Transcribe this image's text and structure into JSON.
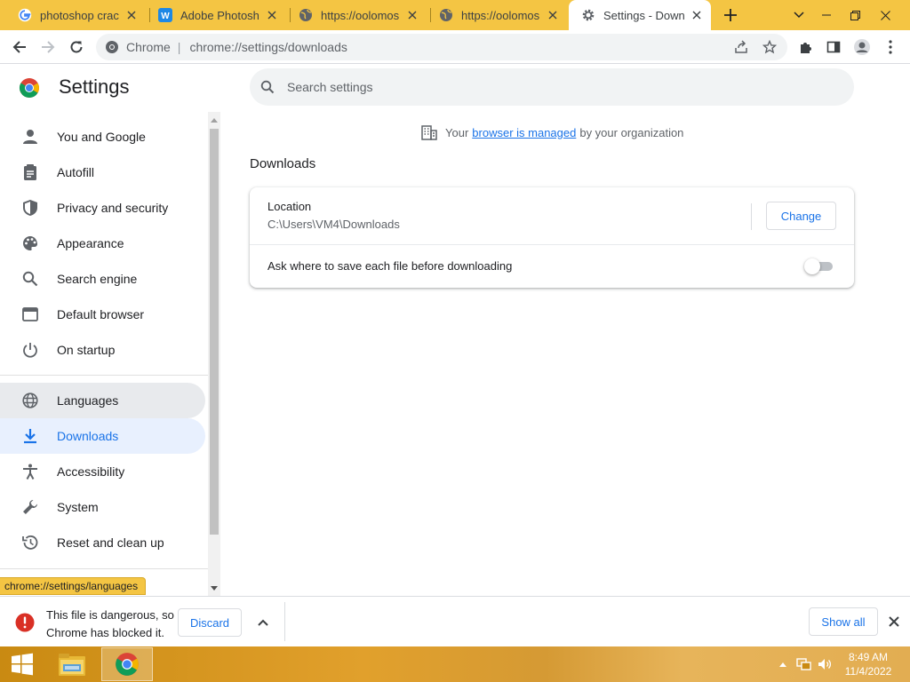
{
  "tabs": [
    {
      "title": "photoshop crack",
      "icon": "google-icon"
    },
    {
      "title": "Adobe Photoshop",
      "icon": "w-site-icon"
    },
    {
      "title": "https://oolomos.c",
      "icon": "globe-icon"
    },
    {
      "title": "https://oolomos.c",
      "icon": "globe-icon"
    },
    {
      "title": "Settings - Downlo",
      "icon": "gear-icon",
      "active": true
    }
  ],
  "toolbar": {
    "site_label": "Chrome",
    "url": "chrome://settings/downloads"
  },
  "settings": {
    "title": "Settings",
    "search_placeholder": "Search settings"
  },
  "sidebar": {
    "items": [
      {
        "label": "You and Google",
        "icon": "person-icon"
      },
      {
        "label": "Autofill",
        "icon": "clipboard-icon"
      },
      {
        "label": "Privacy and security",
        "icon": "shield-icon"
      },
      {
        "label": "Appearance",
        "icon": "palette-icon"
      },
      {
        "label": "Search engine",
        "icon": "search-icon"
      },
      {
        "label": "Default browser",
        "icon": "browser-window-icon"
      },
      {
        "label": "On startup",
        "icon": "power-icon"
      },
      {
        "label": "Languages",
        "icon": "globe-icon",
        "state": "hover"
      },
      {
        "label": "Downloads",
        "icon": "download-icon",
        "state": "selected"
      },
      {
        "label": "Accessibility",
        "icon": "accessibility-icon"
      },
      {
        "label": "System",
        "icon": "wrench-icon"
      },
      {
        "label": "Reset and clean up",
        "icon": "history-reset-icon"
      }
    ],
    "status_url": "chrome://settings/languages"
  },
  "managed": {
    "prefix": "Your",
    "link": "browser is managed",
    "suffix": "by your organization"
  },
  "downloads": {
    "section_title": "Downloads",
    "location_label": "Location",
    "location_path": "C:\\Users\\VM4\\Downloads",
    "change_label": "Change",
    "ask_label": "Ask where to save each file before downloading",
    "ask_enabled": false
  },
  "shelf": {
    "message": "This file is dangerous, so Chrome has blocked it.",
    "discard_label": "Discard",
    "show_all_label": "Show all"
  },
  "taskbar": {
    "time": "8:49 AM",
    "date": "11/4/2022"
  },
  "colors": {
    "accent": "#1a73e8",
    "tabstrip": "#f4c543",
    "selected_nav_bg": "#e8f0fe",
    "danger": "#d93025"
  }
}
